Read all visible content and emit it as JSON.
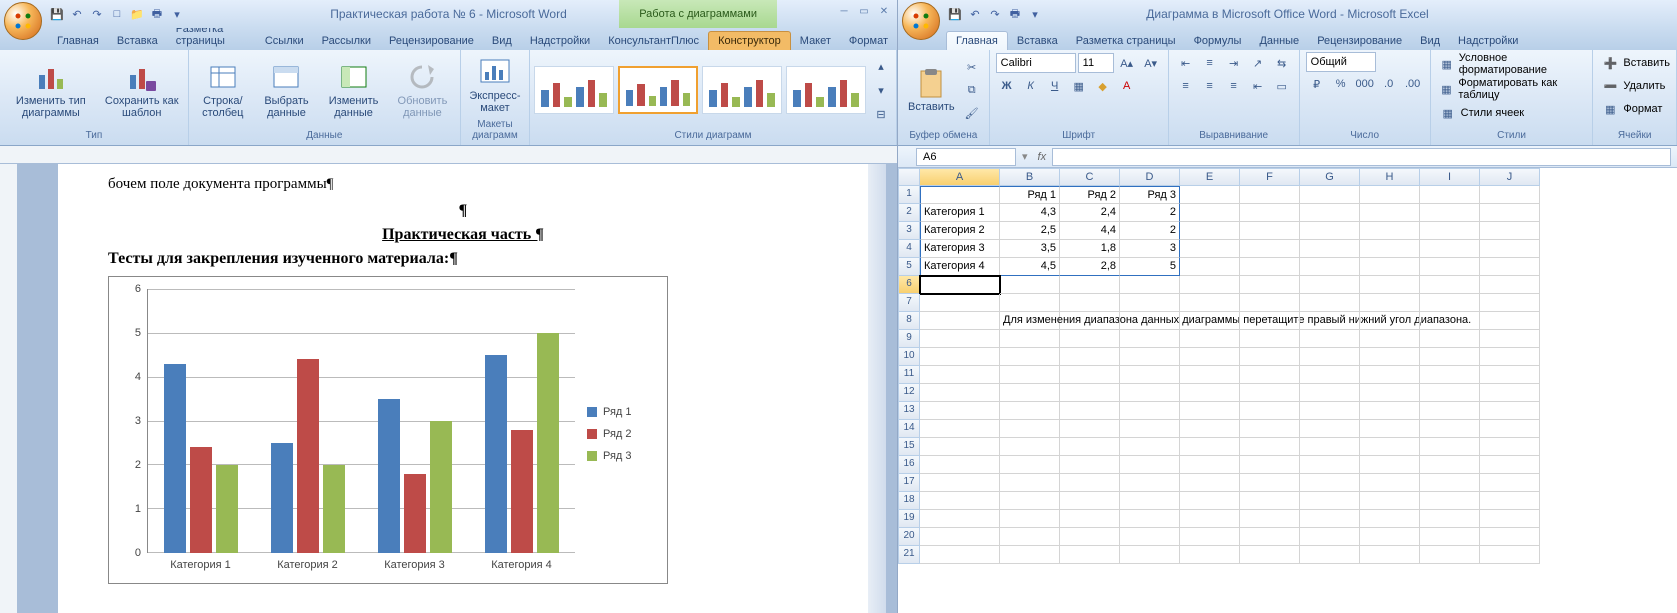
{
  "word": {
    "title": "Практическая работа  № 6 - Microsoft Word",
    "contextual_title": "Работа с диаграммами",
    "tabs": [
      "Главная",
      "Вставка",
      "Разметка страницы",
      "Ссылки",
      "Рассылки",
      "Рецензирование",
      "Вид",
      "Надстройки",
      "КонсультантПлюс",
      "Конструктор",
      "Макет",
      "Формат"
    ],
    "active_tab": "Конструктор",
    "groups": {
      "type": {
        "label": "Тип",
        "btn1": "Изменить тип диаграммы",
        "btn2": "Сохранить как шаблон"
      },
      "data": {
        "label": "Данные",
        "btn1": "Строка/столбец",
        "btn2": "Выбрать данные",
        "btn3": "Изменить данные",
        "btn4": "Обновить данные"
      },
      "layouts": {
        "label": "Макеты диаграмм",
        "btn": "Экспресс-макет"
      },
      "styles": {
        "label": "Стили диаграмм"
      }
    },
    "doc": {
      "line1": "бочем поле документа программы¶",
      "line2": "¶",
      "heading1": "Практическая часть ¶",
      "heading2": "Тесты для закрепления изученного материала:¶"
    }
  },
  "excel": {
    "title": "Диаграмма в Microsoft Office Word - Microsoft Excel",
    "tabs": [
      "Главная",
      "Вставка",
      "Разметка страницы",
      "Формулы",
      "Данные",
      "Рецензирование",
      "Вид",
      "Надстройки"
    ],
    "active_tab": "Главная",
    "groups": {
      "clipboard": {
        "label": "Буфер обмена",
        "paste": "Вставить"
      },
      "font": {
        "label": "Шрифт",
        "name": "Calibri",
        "size": "11"
      },
      "align": {
        "label": "Выравнивание"
      },
      "number": {
        "label": "Число",
        "fmt": "Общий"
      },
      "styles": {
        "label": "Стили",
        "cond": "Условное форматирование",
        "table": "Форматировать как таблицу",
        "cell": "Стили ячеек"
      },
      "cells": {
        "label": "Ячейки",
        "ins": "Вставить",
        "del": "Удалить",
        "fmt": "Формат"
      }
    },
    "namebox": "A6",
    "fx": "fx",
    "columns": [
      "A",
      "B",
      "C",
      "D",
      "E",
      "F",
      "G",
      "H",
      "I",
      "J"
    ],
    "sheet_data": {
      "r1": [
        "",
        "Ряд 1",
        "Ряд 2",
        "Ряд 3"
      ],
      "r2": [
        "Категория 1",
        "4,3",
        "2,4",
        "2"
      ],
      "r3": [
        "Категория 2",
        "2,5",
        "4,4",
        "2"
      ],
      "r4": [
        "Категория 3",
        "3,5",
        "1,8",
        "3"
      ],
      "r5": [
        "Категория 4",
        "4,5",
        "2,8",
        "5"
      ]
    },
    "note": "Для изменения диапазона данных диаграммы перетащите правый нижний угол диапазона."
  },
  "chart_data": {
    "type": "bar",
    "title": "",
    "xlabel": "",
    "ylabel": "",
    "ylim": [
      0,
      6
    ],
    "categories": [
      "Категория 1",
      "Категория 2",
      "Категория 3",
      "Категория 4"
    ],
    "series": [
      {
        "name": "Ряд 1",
        "color": "#4a7ebb",
        "values": [
          4.3,
          2.5,
          3.5,
          4.5
        ]
      },
      {
        "name": "Ряд 2",
        "color": "#be4b48",
        "values": [
          2.4,
          4.4,
          1.8,
          2.8
        ]
      },
      {
        "name": "Ряд 3",
        "color": "#98b954",
        "values": [
          2,
          2,
          3,
          5
        ]
      }
    ],
    "y_ticks": [
      0,
      1,
      2,
      3,
      4,
      5,
      6
    ]
  }
}
